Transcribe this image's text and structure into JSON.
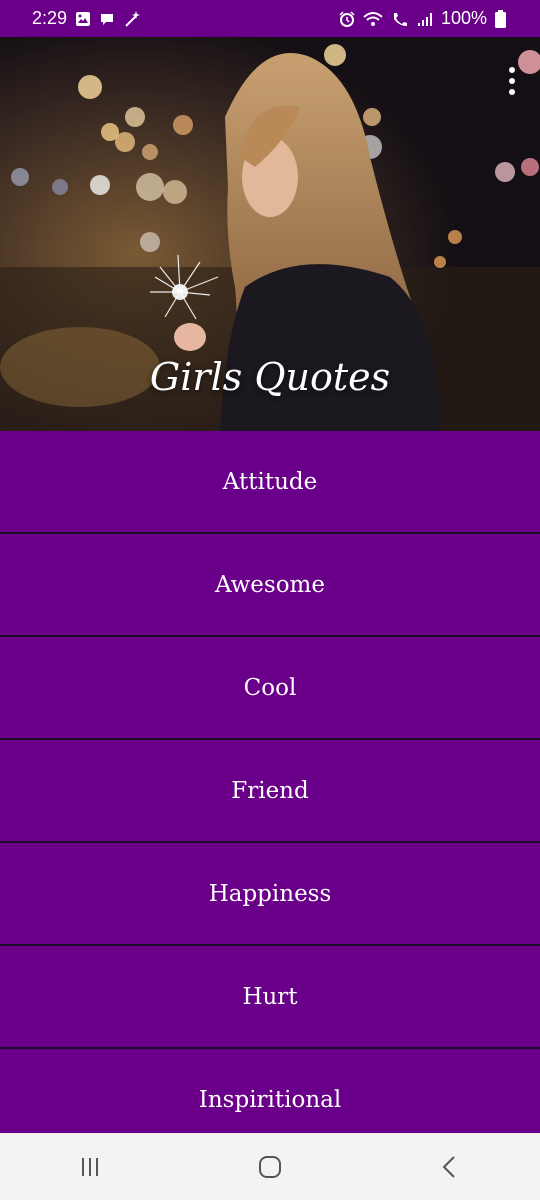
{
  "status_bar": {
    "time": "2:29",
    "battery": "100%",
    "left_icons": [
      "gallery-icon",
      "chat-bubble-icon",
      "magic-wand-icon"
    ],
    "right_icons": [
      "alarm-icon",
      "wifi-icon",
      "wifi-calling-icon",
      "signal-icon",
      "battery-icon"
    ]
  },
  "header": {
    "title": "Girls Quotes",
    "menu_icon": "more-vert-icon"
  },
  "categories": [
    {
      "label": "Attitude"
    },
    {
      "label": "Awesome"
    },
    {
      "label": "Cool"
    },
    {
      "label": "Friend"
    },
    {
      "label": "Happiness"
    },
    {
      "label": "Hurt"
    },
    {
      "label": "Inspiritional"
    }
  ],
  "nav_bar": {
    "buttons": [
      "recent-apps-icon",
      "home-icon",
      "back-icon"
    ]
  },
  "colors": {
    "primary": "#6a008a",
    "divider": "#1e0a2a",
    "nav_bg": "#f3f3f3",
    "text": "#ffffff"
  }
}
